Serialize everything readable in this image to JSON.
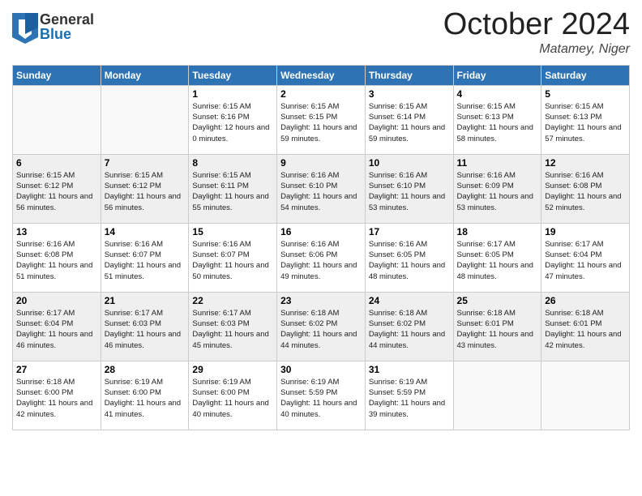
{
  "header": {
    "logo_general": "General",
    "logo_blue": "Blue",
    "month_title": "October 2024",
    "location": "Matamey, Niger"
  },
  "weekdays": [
    "Sunday",
    "Monday",
    "Tuesday",
    "Wednesday",
    "Thursday",
    "Friday",
    "Saturday"
  ],
  "weeks": [
    [
      {
        "day": "",
        "sunrise": "",
        "sunset": "",
        "daylight": ""
      },
      {
        "day": "",
        "sunrise": "",
        "sunset": "",
        "daylight": ""
      },
      {
        "day": "1",
        "sunrise": "Sunrise: 6:15 AM",
        "sunset": "Sunset: 6:16 PM",
        "daylight": "Daylight: 12 hours and 0 minutes."
      },
      {
        "day": "2",
        "sunrise": "Sunrise: 6:15 AM",
        "sunset": "Sunset: 6:15 PM",
        "daylight": "Daylight: 11 hours and 59 minutes."
      },
      {
        "day": "3",
        "sunrise": "Sunrise: 6:15 AM",
        "sunset": "Sunset: 6:14 PM",
        "daylight": "Daylight: 11 hours and 59 minutes."
      },
      {
        "day": "4",
        "sunrise": "Sunrise: 6:15 AM",
        "sunset": "Sunset: 6:13 PM",
        "daylight": "Daylight: 11 hours and 58 minutes."
      },
      {
        "day": "5",
        "sunrise": "Sunrise: 6:15 AM",
        "sunset": "Sunset: 6:13 PM",
        "daylight": "Daylight: 11 hours and 57 minutes."
      }
    ],
    [
      {
        "day": "6",
        "sunrise": "Sunrise: 6:15 AM",
        "sunset": "Sunset: 6:12 PM",
        "daylight": "Daylight: 11 hours and 56 minutes."
      },
      {
        "day": "7",
        "sunrise": "Sunrise: 6:15 AM",
        "sunset": "Sunset: 6:12 PM",
        "daylight": "Daylight: 11 hours and 56 minutes."
      },
      {
        "day": "8",
        "sunrise": "Sunrise: 6:15 AM",
        "sunset": "Sunset: 6:11 PM",
        "daylight": "Daylight: 11 hours and 55 minutes."
      },
      {
        "day": "9",
        "sunrise": "Sunrise: 6:16 AM",
        "sunset": "Sunset: 6:10 PM",
        "daylight": "Daylight: 11 hours and 54 minutes."
      },
      {
        "day": "10",
        "sunrise": "Sunrise: 6:16 AM",
        "sunset": "Sunset: 6:10 PM",
        "daylight": "Daylight: 11 hours and 53 minutes."
      },
      {
        "day": "11",
        "sunrise": "Sunrise: 6:16 AM",
        "sunset": "Sunset: 6:09 PM",
        "daylight": "Daylight: 11 hours and 53 minutes."
      },
      {
        "day": "12",
        "sunrise": "Sunrise: 6:16 AM",
        "sunset": "Sunset: 6:08 PM",
        "daylight": "Daylight: 11 hours and 52 minutes."
      }
    ],
    [
      {
        "day": "13",
        "sunrise": "Sunrise: 6:16 AM",
        "sunset": "Sunset: 6:08 PM",
        "daylight": "Daylight: 11 hours and 51 minutes."
      },
      {
        "day": "14",
        "sunrise": "Sunrise: 6:16 AM",
        "sunset": "Sunset: 6:07 PM",
        "daylight": "Daylight: 11 hours and 51 minutes."
      },
      {
        "day": "15",
        "sunrise": "Sunrise: 6:16 AM",
        "sunset": "Sunset: 6:07 PM",
        "daylight": "Daylight: 11 hours and 50 minutes."
      },
      {
        "day": "16",
        "sunrise": "Sunrise: 6:16 AM",
        "sunset": "Sunset: 6:06 PM",
        "daylight": "Daylight: 11 hours and 49 minutes."
      },
      {
        "day": "17",
        "sunrise": "Sunrise: 6:16 AM",
        "sunset": "Sunset: 6:05 PM",
        "daylight": "Daylight: 11 hours and 48 minutes."
      },
      {
        "day": "18",
        "sunrise": "Sunrise: 6:17 AM",
        "sunset": "Sunset: 6:05 PM",
        "daylight": "Daylight: 11 hours and 48 minutes."
      },
      {
        "day": "19",
        "sunrise": "Sunrise: 6:17 AM",
        "sunset": "Sunset: 6:04 PM",
        "daylight": "Daylight: 11 hours and 47 minutes."
      }
    ],
    [
      {
        "day": "20",
        "sunrise": "Sunrise: 6:17 AM",
        "sunset": "Sunset: 6:04 PM",
        "daylight": "Daylight: 11 hours and 46 minutes."
      },
      {
        "day": "21",
        "sunrise": "Sunrise: 6:17 AM",
        "sunset": "Sunset: 6:03 PM",
        "daylight": "Daylight: 11 hours and 46 minutes."
      },
      {
        "day": "22",
        "sunrise": "Sunrise: 6:17 AM",
        "sunset": "Sunset: 6:03 PM",
        "daylight": "Daylight: 11 hours and 45 minutes."
      },
      {
        "day": "23",
        "sunrise": "Sunrise: 6:18 AM",
        "sunset": "Sunset: 6:02 PM",
        "daylight": "Daylight: 11 hours and 44 minutes."
      },
      {
        "day": "24",
        "sunrise": "Sunrise: 6:18 AM",
        "sunset": "Sunset: 6:02 PM",
        "daylight": "Daylight: 11 hours and 44 minutes."
      },
      {
        "day": "25",
        "sunrise": "Sunrise: 6:18 AM",
        "sunset": "Sunset: 6:01 PM",
        "daylight": "Daylight: 11 hours and 43 minutes."
      },
      {
        "day": "26",
        "sunrise": "Sunrise: 6:18 AM",
        "sunset": "Sunset: 6:01 PM",
        "daylight": "Daylight: 11 hours and 42 minutes."
      }
    ],
    [
      {
        "day": "27",
        "sunrise": "Sunrise: 6:18 AM",
        "sunset": "Sunset: 6:00 PM",
        "daylight": "Daylight: 11 hours and 42 minutes."
      },
      {
        "day": "28",
        "sunrise": "Sunrise: 6:19 AM",
        "sunset": "Sunset: 6:00 PM",
        "daylight": "Daylight: 11 hours and 41 minutes."
      },
      {
        "day": "29",
        "sunrise": "Sunrise: 6:19 AM",
        "sunset": "Sunset: 6:00 PM",
        "daylight": "Daylight: 11 hours and 40 minutes."
      },
      {
        "day": "30",
        "sunrise": "Sunrise: 6:19 AM",
        "sunset": "Sunset: 5:59 PM",
        "daylight": "Daylight: 11 hours and 40 minutes."
      },
      {
        "day": "31",
        "sunrise": "Sunrise: 6:19 AM",
        "sunset": "Sunset: 5:59 PM",
        "daylight": "Daylight: 11 hours and 39 minutes."
      },
      {
        "day": "",
        "sunrise": "",
        "sunset": "",
        "daylight": ""
      },
      {
        "day": "",
        "sunrise": "",
        "sunset": "",
        "daylight": ""
      }
    ]
  ]
}
